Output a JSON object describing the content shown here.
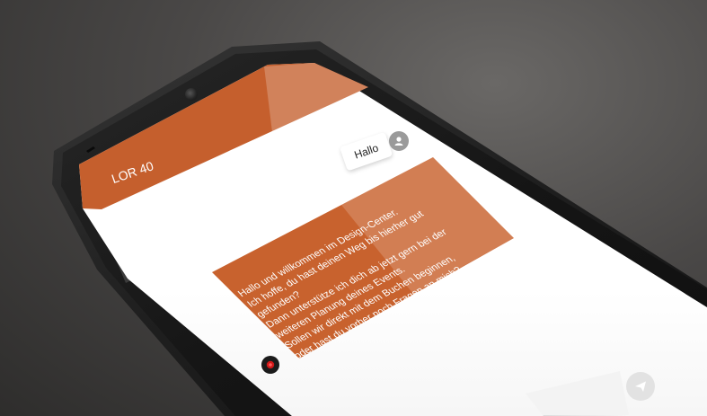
{
  "header": {
    "title": "LOR 40"
  },
  "user_message": {
    "text": "Hallo",
    "avatar_icon": "user-avatar-icon"
  },
  "bot_message": {
    "lines": [
      "Hallo und willkommen im Design-Center.",
      "Ich hoffe, du hast deinen Weg bis hierher gut",
      "gefunden?",
      "Dann unterstütze ich dich ab jetzt gern bei der",
      "weiteren Planung deines Events.",
      "Sollen wir direkt mit dem Buchen beginnen,",
      "oder hast du vorher noch Fragen an mich?"
    ],
    "avatar_icon": "bot-avatar-icon"
  },
  "input": {
    "send_icon": "send-icon"
  },
  "colors": {
    "accent": "#c55f2d",
    "accent_light": "#d98a5e",
    "bubble_bg": "#ffffff"
  }
}
